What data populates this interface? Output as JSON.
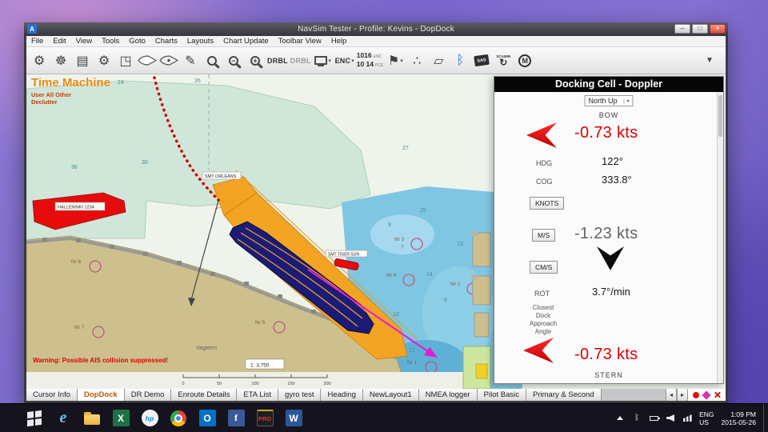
{
  "window": {
    "title": "NavSim Tester - Profile: Kevins - DopDock",
    "app_initial": "A",
    "controls": {
      "minimize": "–",
      "maximize": "□",
      "close": "×"
    }
  },
  "menu": {
    "items": [
      "File",
      "Edit",
      "View",
      "Tools",
      "Goto",
      "Charts",
      "Layouts",
      "Chart Update",
      "Toolbar View",
      "Help"
    ]
  },
  "toolbar": {
    "icons": {
      "settings": "⚙",
      "helm": "☸",
      "panels": "▤",
      "gear": "⚙",
      "frame": "◳",
      "brush": "✎",
      "zoom_out": "−",
      "zoom_in": "+",
      "route_flag": "⚑",
      "nodes": "∴",
      "eraser": "▱",
      "bluetooth": "ᛒ",
      "refresh": "↻",
      "caret": "▾",
      "overflow": "▼"
    },
    "drbl_active": "DRBL",
    "drbl_inactive": "DRBL",
    "enc_button": "ENC",
    "num_top": "1016",
    "num_top_label": "ENC",
    "num_bottom": "10 14",
    "num_bottom_label": "PCE",
    "sas_badge": "SAS",
    "scamin_label": "SCAMIN",
    "m_badge": "M"
  },
  "chart": {
    "heading": "Time Machine",
    "sub1": "User All Other",
    "sub2": "Declutter",
    "warning": "Warning: Possible AIS collision suppressed!",
    "scale_label": "1: 3,750",
    "scale_ticks": [
      "0",
      "50",
      "100",
      "150",
      "200"
    ],
    "vessels": {
      "red": "HALLENINKI 1234",
      "orleans": "SMT ORLEANS",
      "tiger": "SMT TIGER SUN"
    },
    "place": "Vagterm",
    "buoys": [
      "Nr 1",
      "Nr 2",
      "Nr 3",
      "Nr 4",
      "Nr 5",
      "Nr 6",
      "Nr 7"
    ],
    "depths": [
      "36",
      "30",
      "24",
      "27",
      "25",
      "9",
      "7",
      "14",
      "13",
      "18",
      "6",
      "17",
      "26"
    ]
  },
  "docking": {
    "title": "Docking Cell - Doppler",
    "orientation": "North Up",
    "bow_label": "BOW",
    "bow_speed": "-0.73 kts",
    "hdg_label": "HDG",
    "hdg_value": "122°",
    "cog_label": "COG",
    "cog_value": "333.8°",
    "knots_button": "KNOTS",
    "ms_button": "M/S",
    "ms_value": "-1.23 kts",
    "cms_button": "CM/S",
    "rot_label": "ROT",
    "rot_value": "3.7°/min",
    "closest_lines": [
      "Closest",
      "Dock",
      "Approach",
      "Angle"
    ],
    "stern_speed": "-0.73 kts",
    "stern_label": "STERN"
  },
  "tabs": {
    "items": [
      "Cursor Info",
      "DopDock",
      "DR Demo",
      "Enroute Details",
      "ETA List",
      "gyro test",
      "Heading",
      "NewLayout1",
      "NMEA logger",
      "Pilot Basic",
      "Primary & Second"
    ],
    "scroll_left": "◂",
    "scroll_right": "▸"
  },
  "taskbar": {
    "ie": "e",
    "excel": "X",
    "hp": "hp",
    "outlook": "O",
    "facebook": "f",
    "pro": "PRO",
    "word": "W",
    "bluetooth": "ᛒ",
    "lang": "ENG",
    "region": "US",
    "time": "1:09 PM",
    "date": "2015-05-26"
  }
}
